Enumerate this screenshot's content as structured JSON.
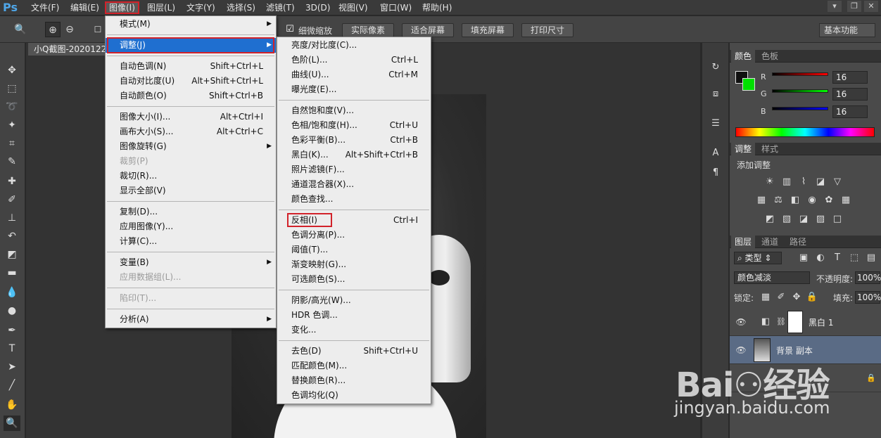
{
  "app": {
    "logo": "Ps"
  },
  "menubar": {
    "items": [
      "文件(F)",
      "编辑(E)",
      "图像(I)",
      "图层(L)",
      "文字(Y)",
      "选择(S)",
      "滤镜(T)",
      "3D(D)",
      "视图(V)",
      "窗口(W)",
      "帮助(H)"
    ],
    "active_index": 2,
    "window_controls": [
      "▾",
      "—",
      "❐",
      "✕"
    ]
  },
  "optionsbar": {
    "fine_zoom_label": "细微缩放",
    "buttons": [
      "实际像素",
      "适合屏幕",
      "填充屏幕",
      "打印尺寸"
    ],
    "workspace": "基本功能"
  },
  "document": {
    "tab_title": "小Q截图-2020122"
  },
  "image_menu": [
    {
      "label": "模式(M)",
      "submenu": true
    },
    {
      "sep": true
    },
    {
      "label": "调整(J)",
      "submenu": true,
      "highlighted": true
    },
    {
      "sep": true
    },
    {
      "label": "自动色调(N)",
      "shortcut": "Shift+Ctrl+L"
    },
    {
      "label": "自动对比度(U)",
      "shortcut": "Alt+Shift+Ctrl+L"
    },
    {
      "label": "自动颜色(O)",
      "shortcut": "Shift+Ctrl+B"
    },
    {
      "sep": true
    },
    {
      "label": "图像大小(I)...",
      "shortcut": "Alt+Ctrl+I"
    },
    {
      "label": "画布大小(S)...",
      "shortcut": "Alt+Ctrl+C"
    },
    {
      "label": "图像旋转(G)",
      "submenu": true
    },
    {
      "label": "裁剪(P)",
      "disabled": true
    },
    {
      "label": "裁切(R)..."
    },
    {
      "label": "显示全部(V)"
    },
    {
      "sep": true
    },
    {
      "label": "复制(D)..."
    },
    {
      "label": "应用图像(Y)..."
    },
    {
      "label": "计算(C)..."
    },
    {
      "sep": true
    },
    {
      "label": "变量(B)",
      "submenu": true
    },
    {
      "label": "应用数据组(L)...",
      "disabled": true
    },
    {
      "sep": true
    },
    {
      "label": "陷印(T)...",
      "disabled": true
    },
    {
      "sep": true
    },
    {
      "label": "分析(A)",
      "submenu": true
    }
  ],
  "adjust_menu": [
    {
      "label": "亮度/对比度(C)..."
    },
    {
      "label": "色阶(L)...",
      "shortcut": "Ctrl+L"
    },
    {
      "label": "曲线(U)...",
      "shortcut": "Ctrl+M"
    },
    {
      "label": "曝光度(E)..."
    },
    {
      "sep": true
    },
    {
      "label": "自然饱和度(V)..."
    },
    {
      "label": "色相/饱和度(H)...",
      "shortcut": "Ctrl+U"
    },
    {
      "label": "色彩平衡(B)...",
      "shortcut": "Ctrl+B"
    },
    {
      "label": "黑白(K)...",
      "shortcut": "Alt+Shift+Ctrl+B"
    },
    {
      "label": "照片滤镜(F)..."
    },
    {
      "label": "通道混合器(X)..."
    },
    {
      "label": "颜色查找..."
    },
    {
      "sep": true
    },
    {
      "label": "反相(I)",
      "shortcut": "Ctrl+I",
      "boxed": true
    },
    {
      "label": "色调分离(P)..."
    },
    {
      "label": "阈值(T)..."
    },
    {
      "label": "渐变映射(G)..."
    },
    {
      "label": "可选颜色(S)..."
    },
    {
      "sep": true
    },
    {
      "label": "阴影/高光(W)..."
    },
    {
      "label": "HDR 色调..."
    },
    {
      "label": "变化..."
    },
    {
      "sep": true
    },
    {
      "label": "去色(D)",
      "shortcut": "Shift+Ctrl+U"
    },
    {
      "label": "匹配颜色(M)..."
    },
    {
      "label": "替换颜色(R)..."
    },
    {
      "label": "色调均化(Q)"
    }
  ],
  "color_panel": {
    "tabs": [
      "颜色",
      "色板"
    ],
    "r_label": "R",
    "g_label": "G",
    "b_label": "B",
    "r": "16",
    "g": "16",
    "b": "16",
    "fg_color": "#101010",
    "bg_color": "#00e000"
  },
  "adjust_panel": {
    "tabs": [
      "调整",
      "样式"
    ],
    "title": "添加调整"
  },
  "layers_panel": {
    "tabs": [
      "图层",
      "通道",
      "路径"
    ],
    "filter": "类型",
    "blend_mode": "颜色减淡",
    "opacity_label": "不透明度:",
    "opacity": "100%",
    "lock_label": "锁定:",
    "fill_label": "填充:",
    "fill": "100%",
    "layers": [
      {
        "name": "黑白 1"
      },
      {
        "name": "背景 副本",
        "selected": true
      }
    ]
  },
  "watermark": {
    "logo": "Bai⚇经验",
    "url": "jingyan.baidu.com"
  }
}
